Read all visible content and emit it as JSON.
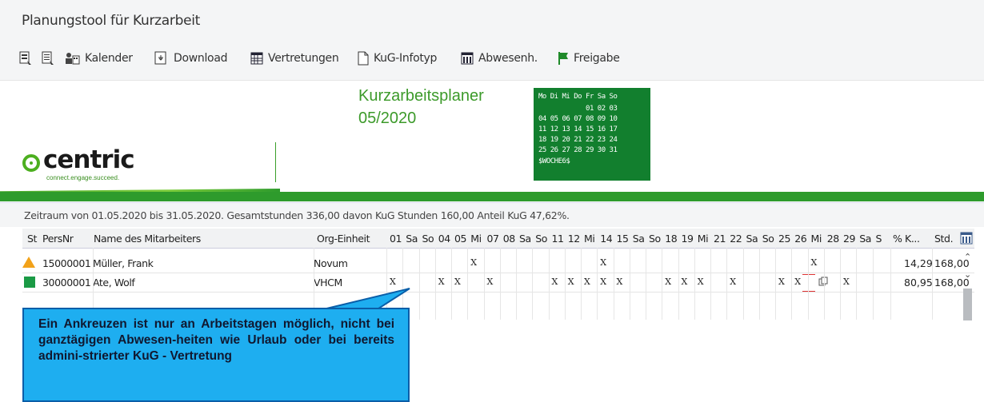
{
  "window": {
    "title": "Planungstool für Kurzarbeit"
  },
  "toolbar": {
    "items": [
      {
        "label": "",
        "icon": "select-all-icon"
      },
      {
        "label": "",
        "icon": "deselect-icon"
      },
      {
        "label": "Kalender",
        "icon": "calendar-people-icon"
      },
      {
        "label": "Download",
        "icon": "download-icon"
      },
      {
        "label": "Vertretungen",
        "icon": "table-icon"
      },
      {
        "label": "KuG-Infotyp",
        "icon": "document-icon"
      },
      {
        "label": "Abwesenh.",
        "icon": "columns-icon"
      },
      {
        "label": "Freigabe",
        "icon": "flag-icon"
      }
    ]
  },
  "header": {
    "logo_word": "centric",
    "logo_tagline": "connect.engage.succeed.",
    "planner_title": "Kurzarbeitsplaner",
    "planner_period": "05/2020"
  },
  "calendar": {
    "rows": [
      "Mo Di Mi Do Fr Sa So",
      "            01 02 03",
      "04 05 06 07 08 09 10",
      "11 12 13 14 15 16 17",
      "18 19 20 21 22 23 24",
      "25 26 27 28 29 30 31",
      "$WOCHE6$"
    ]
  },
  "summary": {
    "text": "Zeitraum von 01.05.2020 bis 31.05.2020. Gesamtstunden 336,00 davon KuG Stunden 160,00 Anteil KuG 47,62%."
  },
  "table": {
    "columns": {
      "st": "St",
      "persnr": "PersNr",
      "name": "Name des Mitarbeiters",
      "org": "Org-Einheit",
      "days": [
        "01",
        "Sa",
        "So",
        "04",
        "05",
        "Mi",
        "07",
        "08",
        "Sa",
        "So",
        "11",
        "12",
        "Mi",
        "14",
        "15",
        "Sa",
        "So",
        "18",
        "19",
        "Mi",
        "21",
        "22",
        "Sa",
        "So",
        "25",
        "26",
        "Mi",
        "28",
        "29",
        "Sa",
        "S"
      ],
      "pct": "% K...",
      "std": "Std."
    },
    "rows": [
      {
        "status": "warning",
        "persnr": "15000001",
        "name": "Müller, Frank",
        "org": "Novum",
        "marks": [
          5,
          13,
          26
        ],
        "pct": "14,29",
        "std": "168,00"
      },
      {
        "status": "ok",
        "persnr": "30000001",
        "name": "Ate, Wolf",
        "org": "VHCM",
        "marks": [
          0,
          3,
          4,
          6,
          10,
          11,
          12,
          13,
          14,
          17,
          18,
          19,
          21,
          24,
          25,
          28
        ],
        "pct": "80,95",
        "std": "168,00"
      }
    ]
  },
  "callout": {
    "text": "Ein Ankreuzen ist nur an Arbeitstagen möglich, nicht bei ganztägigen Abwesen-heiten wie Urlaub oder bei bereits admini-strierter KuG - Vertretung"
  },
  "colors": {
    "brand_green": "#2e9b2c",
    "calendar_bg": "#127f2e",
    "callout_bg": "#1eaef0",
    "warning": "#f2a21a",
    "ok": "#1a9a45"
  }
}
